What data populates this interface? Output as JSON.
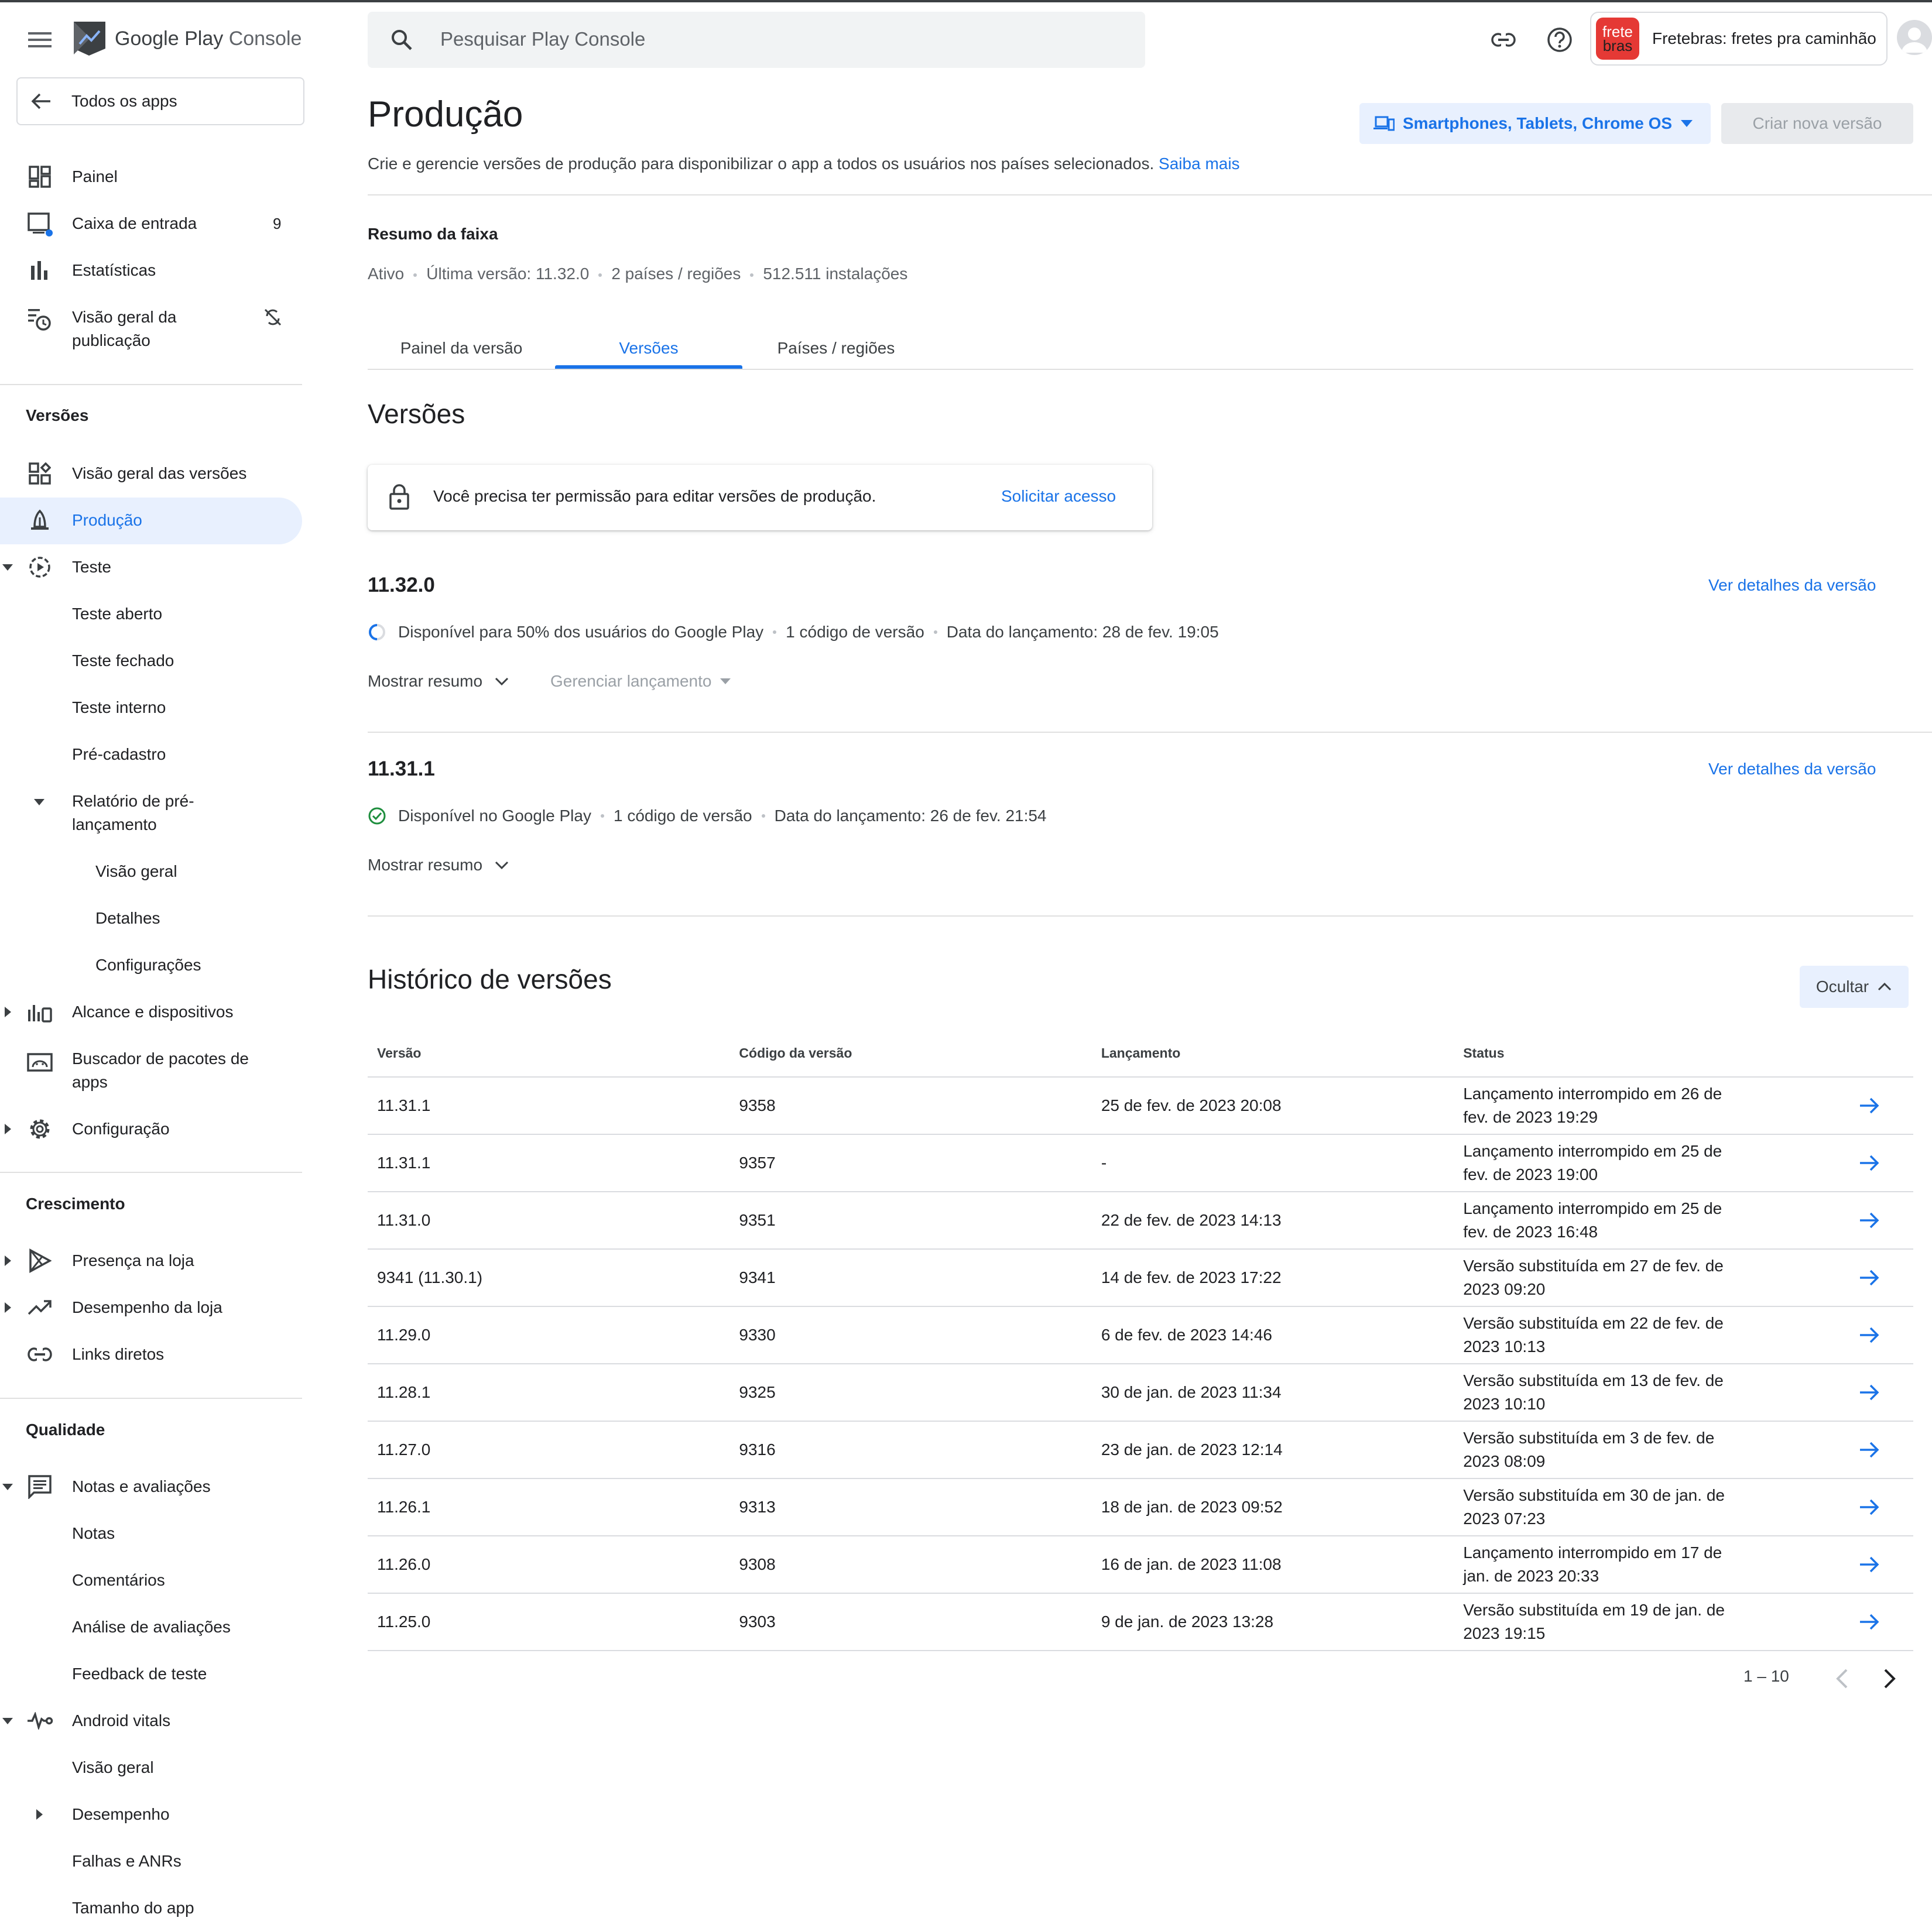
{
  "app": {
    "logo_text": "Google Play Console",
    "logo_word1": "Google Play",
    "logo_word2": "Console",
    "search_placeholder": "Pesquisar Play Console",
    "developer_name": "Fretebras: fretes pra caminhão",
    "developer_logo_text1": "frete",
    "developer_logo_text2": "bras",
    "brand_color": "#1a73e8"
  },
  "sidebar": {
    "back_label": "Todos os apps",
    "top_items": [
      {
        "label": "Painel",
        "icon": "dashboard-icon"
      },
      {
        "label": "Caixa de entrada",
        "icon": "inbox-icon",
        "badge": "9"
      },
      {
        "label": "Estatísticas",
        "icon": "bar-chart-icon"
      },
      {
        "label": "Visão geral da publicação",
        "icon": "publishing-overview-icon"
      }
    ],
    "section_versions": "Versões",
    "versions_items": [
      {
        "label": "Visão geral das versões",
        "icon": "releases-overview-icon"
      },
      {
        "label": "Produção",
        "icon": "production-icon",
        "active": true
      },
      {
        "label": "Teste",
        "icon": "testing-icon"
      },
      {
        "label": "Teste aberto"
      },
      {
        "label": "Teste fechado"
      },
      {
        "label": "Teste interno"
      },
      {
        "label": "Pré-cadastro"
      },
      {
        "label": "Relatório de pré-lançamento"
      },
      {
        "label": "Visão geral"
      },
      {
        "label": "Detalhes"
      },
      {
        "label": "Configurações"
      },
      {
        "label": "Alcance e dispositivos",
        "icon": "reach-devices-icon"
      },
      {
        "label": "Buscador de pacotes de apps",
        "icon": "app-bundle-explorer-icon"
      },
      {
        "label": "Configuração",
        "icon": "gear-icon"
      }
    ],
    "section_growth": "Crescimento",
    "growth_items": [
      {
        "label": "Presença na loja",
        "icon": "store-presence-icon"
      },
      {
        "label": "Desempenho da loja",
        "icon": "trending-up-icon"
      },
      {
        "label": "Links diretos",
        "icon": "link-icon"
      }
    ],
    "section_quality": "Qualidade",
    "quality_items": [
      {
        "label": "Notas e avaliações",
        "icon": "ratings-icon"
      },
      {
        "label": "Notas"
      },
      {
        "label": "Comentários"
      },
      {
        "label": "Análise de avaliações"
      },
      {
        "label": "Feedback de teste"
      },
      {
        "label": "Android vitals",
        "icon": "vitals-icon"
      },
      {
        "label": "Visão geral"
      },
      {
        "label": "Desempenho"
      },
      {
        "label": "Falhas e ANRs"
      },
      {
        "label": "Tamanho do app"
      }
    ]
  },
  "header": {
    "title": "Produção",
    "description": "Crie e gerencie versões de produção para disponibilizar o app a todos os usuários nos países selecionados.",
    "learn_more": "Saiba mais",
    "device_selector": "Smartphones, Tablets, Chrome OS",
    "create_button": "Criar nova versão"
  },
  "track_summary": {
    "title": "Resumo da faixa",
    "status": "Ativo",
    "latest": "Última versão: 11.32.0",
    "countries": "2 países / regiões",
    "installs": "512.511 instalações"
  },
  "tabs": [
    "Painel da versão",
    "Versões",
    "Países / regiões"
  ],
  "versions": {
    "title": "Versões",
    "permission_message": "Você precisa ter permissão para editar versões de produção.",
    "request_access": "Solicitar acesso",
    "items": [
      {
        "name": "11.32.0",
        "details_link": "Ver detalhes da versão",
        "status": "Disponível para 50% dos usuários do Google Play",
        "codes": "1 código de versão",
        "date": "Data do lançamento: 28 de fev. 19:05",
        "show_summary": "Mostrar resumo",
        "manage": "Gerenciar lançamento"
      },
      {
        "name": "11.31.1",
        "details_link": "Ver detalhes da versão",
        "status": "Disponível no Google Play",
        "codes": "1 código de versão",
        "date": "Data do lançamento: 26 de fev. 21:54",
        "show_summary": "Mostrar resumo"
      }
    ]
  },
  "history": {
    "title": "Histórico de versões",
    "hide_button": "Ocultar",
    "columns": [
      "Versão",
      "Código da versão",
      "Lançamento",
      "Status"
    ],
    "rows": [
      {
        "version": "11.31.1",
        "code": "9358",
        "launch": "25 de fev. de 2023 20:08",
        "status1": "Lançamento interrompido em 26 de",
        "status2": "fev. de 2023 19:29"
      },
      {
        "version": "11.31.1",
        "code": "9357",
        "launch": "-",
        "status1": "Lançamento interrompido em 25 de",
        "status2": "fev. de 2023 19:00"
      },
      {
        "version": "11.31.0",
        "code": "9351",
        "launch": "22 de fev. de 2023 14:13",
        "status1": "Lançamento interrompido em 25 de",
        "status2": "fev. de 2023 16:48"
      },
      {
        "version": "9341 (11.30.1)",
        "code": "9341",
        "launch": "14 de fev. de 2023 17:22",
        "status1": "Versão substituída em 27 de fev. de",
        "status2": "2023 09:20"
      },
      {
        "version": "11.29.0",
        "code": "9330",
        "launch": "6 de fev. de 2023 14:46",
        "status1": "Versão substituída em 22 de fev. de",
        "status2": "2023 10:13"
      },
      {
        "version": "11.28.1",
        "code": "9325",
        "launch": "30 de jan. de 2023 11:34",
        "status1": "Versão substituída em 13 de fev. de",
        "status2": "2023 10:10"
      },
      {
        "version": "11.27.0",
        "code": "9316",
        "launch": "23 de jan. de 2023 12:14",
        "status1": "Versão substituída em 3 de fev. de",
        "status2": "2023 08:09"
      },
      {
        "version": "11.26.1",
        "code": "9313",
        "launch": "18 de jan. de 2023 09:52",
        "status1": "Versão substituída em 30 de jan. de",
        "status2": "2023 07:23"
      },
      {
        "version": "11.26.0",
        "code": "9308",
        "launch": "16 de jan. de 2023 11:08",
        "status1": "Lançamento interrompido em 17 de",
        "status2": "jan. de 2023 20:33"
      },
      {
        "version": "11.25.0",
        "code": "9303",
        "launch": "9 de jan. de 2023 13:28",
        "status1": "Versão substituída em 19 de jan. de",
        "status2": "2023 19:15"
      }
    ],
    "pagination": "1 – 10"
  }
}
